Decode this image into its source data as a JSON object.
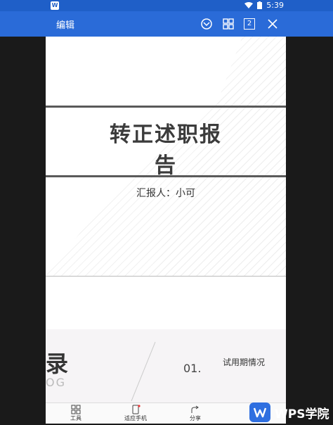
{
  "status_bar": {
    "app_badge": "W",
    "time": "5:39"
  },
  "toolbar": {
    "edit_label": "编辑",
    "page_count": "2"
  },
  "document": {
    "title_line1": "转正述职报",
    "title_line2": "告",
    "reporter": "汇报人：小可",
    "toc_big": "录",
    "toc_en": "OG",
    "toc_num": "01.",
    "toc_item": "试用期情况"
  },
  "bottom_bar": {
    "items": [
      {
        "label": "工具"
      },
      {
        "label": "适应手机"
      },
      {
        "label": "分享"
      },
      {
        "label": "..."
      }
    ]
  },
  "watermark": {
    "text": "WPS学院"
  },
  "colors": {
    "toolbar": "#2a6bd8",
    "status_bar": "#1f5fc8",
    "brand": "#2f6fe0"
  }
}
